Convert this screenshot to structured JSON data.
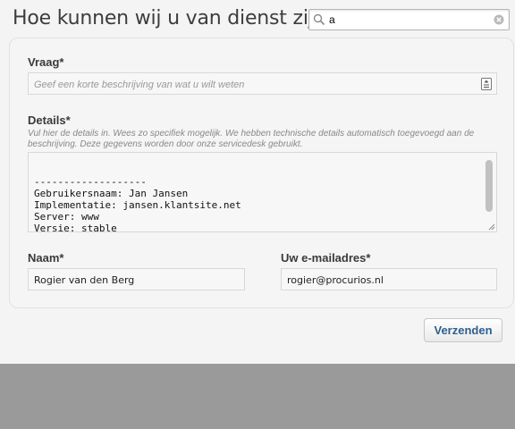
{
  "header": {
    "title": "Hoe kunnen wij u van dienst zijn?",
    "search": {
      "value": "a",
      "placeholder": ""
    }
  },
  "form": {
    "vraag": {
      "label": "Vraag*",
      "placeholder": "Geef een korte beschrijving van wat u wilt weten",
      "value": ""
    },
    "details": {
      "label": "Details*",
      "help": "Vul hier de details in. Wees zo specifiek mogelijk. We hebben technische details automatisch toegevoegd aan de beschrijving. Deze gegevens worden door onze servicedesk gebruikt.",
      "value": "\n\n-------------------\nGebruikersnaam: Jan Jansen\nImplementatie: jansen.klantsite.net\nServer: www\nVersie: stable"
    },
    "naam": {
      "label": "Naam*",
      "value": "Rogier van den Berg"
    },
    "email": {
      "label": "Uw e-mailadres*",
      "value": "rogier@procurios.nl"
    }
  },
  "actions": {
    "submit_label": "Verzenden"
  },
  "colors": {
    "accent": "#2f5f8a",
    "overlay": "#9a9a9a"
  },
  "icons": {
    "search": "search-icon",
    "clear": "clear-icon",
    "vraag": "document-icon",
    "resize": "resize-handle-icon"
  }
}
